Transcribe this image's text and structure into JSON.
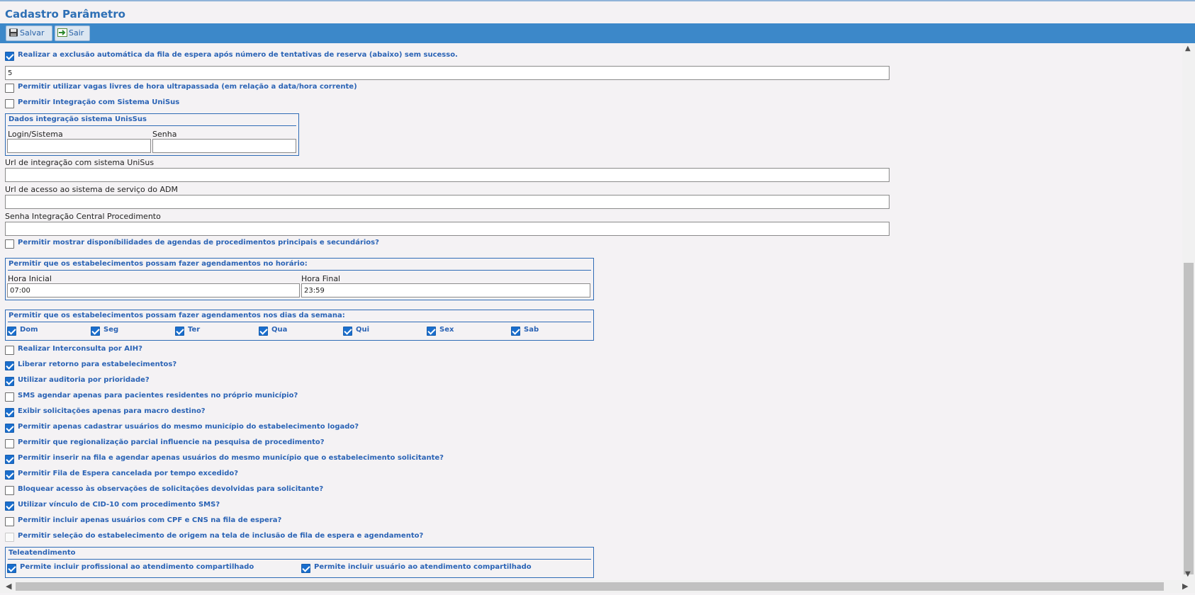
{
  "window": {
    "title": "Cadastro Parâmetro"
  },
  "toolbar": {
    "save_label": "Salvar",
    "exit_label": "Sair"
  },
  "options": {
    "auto_exclusion": {
      "label": "Realizar a exclusão automática da fila de espera após número de tentativas de reserva (abaixo) sem sucesso.",
      "checked": true
    },
    "attempts_value": "5",
    "free_slots": {
      "label": "Permitir utilizar vagas livres de hora ultrapassada (em relação a data/hora corrente)",
      "checked": false
    },
    "unisus_integration": {
      "label": "Permitir Integração com Sistema UniSus",
      "checked": false
    }
  },
  "unisus_box": {
    "legend": "Dados integração sistema UnisSus",
    "login_label": "Login/Sistema",
    "login_value": "",
    "password_label": "Senha",
    "password_value": ""
  },
  "urls": {
    "unisus_label": "Url de integração com sistema UniSus",
    "unisus_value": "",
    "adm_label": "Url de acesso ao sistema de serviço do ADM",
    "adm_value": "",
    "central_password_label": "Senha Integração Central Procedimento",
    "central_password_value": ""
  },
  "show_availability": {
    "label": "Permitir mostrar disponíbilidades de agendas de procedimentos principais e secundários?",
    "checked": false
  },
  "hours_box": {
    "legend": "Permitir que os estabelecimentos possam fazer agendamentos no horário:",
    "start_label": "Hora Inicial",
    "start_value": "07:00",
    "end_label": "Hora Final",
    "end_value": "23:59"
  },
  "days_box": {
    "legend": "Permitir que os estabelecimentos possam fazer agendamentos nos dias da semana:",
    "days": [
      {
        "label": "Dom",
        "checked": true
      },
      {
        "label": "Seg",
        "checked": true
      },
      {
        "label": "Ter",
        "checked": true
      },
      {
        "label": "Qua",
        "checked": true
      },
      {
        "label": "Qui",
        "checked": true
      },
      {
        "label": "Sex",
        "checked": true
      },
      {
        "label": "Sab",
        "checked": true
      }
    ]
  },
  "checklist": [
    {
      "label": "Realizar Interconsulta por AIH?",
      "checked": false
    },
    {
      "label": "Liberar retorno para estabelecimentos?",
      "checked": true
    },
    {
      "label": "Utilizar auditoria por prioridade?",
      "checked": true
    },
    {
      "label": "SMS agendar apenas para pacientes residentes no próprio município?",
      "checked": false
    },
    {
      "label": "Exibir solicitações apenas para macro destino?",
      "checked": true
    },
    {
      "label": "Permitir apenas cadastrar usuários do mesmo município do estabelecimento logado?",
      "checked": true
    },
    {
      "label": "Permitir que regionalização parcial influencie na pesquisa de procedimento?",
      "checked": false
    },
    {
      "label": "Permitir inserir na fila e agendar apenas usuários do mesmo município que o estabelecimento solicitante?",
      "checked": true
    },
    {
      "label": "Permitir Fila de Espera cancelada por tempo excedido?",
      "checked": true
    },
    {
      "label": "Bloquear acesso às observações de solicitações devolvidas para solicitante?",
      "checked": false
    },
    {
      "label": "Utilizar vínculo de CID-10 com procedimento SMS?",
      "checked": true
    },
    {
      "label": "Permitir incluir apenas usuários com CPF e CNS na fila de espera?",
      "checked": false
    },
    {
      "label": "Permitir seleção do estabelecimento de origem na tela de inclusão de fila de espera e agendamento?",
      "checked": false,
      "disabled": true
    }
  ],
  "tele_box": {
    "legend": "Teleatendimento",
    "items": [
      {
        "label": "Permite incluir profissional ao atendimento compartilhado",
        "checked": true
      },
      {
        "label": "Permite incluir usuário ao atendimento compartilhado",
        "checked": true
      }
    ]
  },
  "colors": {
    "accent": "#3c88c9",
    "title": "#2d6fb5",
    "label": "#2a63b5",
    "checkbox": "#1a6ecd"
  }
}
